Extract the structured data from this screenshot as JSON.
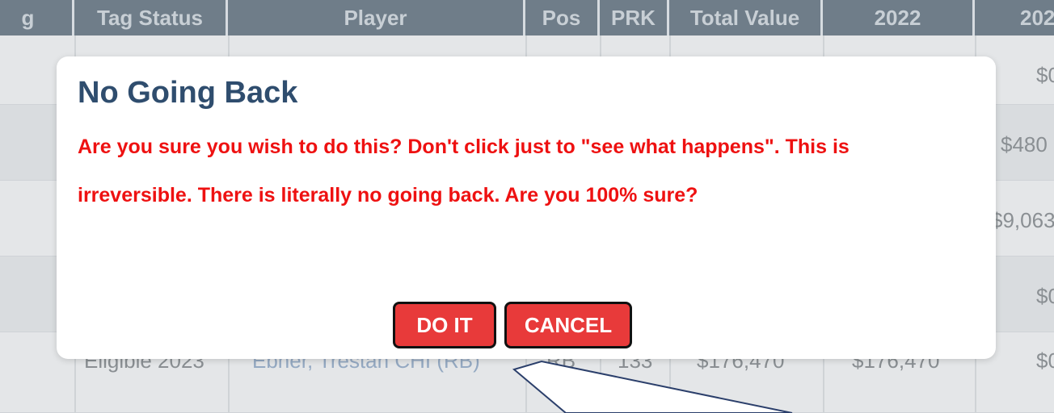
{
  "table": {
    "headers": [
      "g",
      "Tag Status",
      "Player",
      "Pos",
      "PRK",
      "Total Value",
      "2022",
      "202"
    ],
    "visible_row": {
      "tag_status": "Eligible 2023",
      "player": "Ebner, Trestan CHI (RB)",
      "pos": "RB",
      "prk": "133",
      "total_value": "$176,470",
      "value_2022": "$176,470",
      "value_2023": "$0"
    },
    "right_edge_values": [
      "$0",
      "$480",
      "$9,063",
      "$0"
    ]
  },
  "modal": {
    "title": "No Going Back",
    "message": "Are you sure you wish to do this? Don't click just to \"see what happens\". This is irreversible. There is literally no going back. Are you 100% sure?",
    "confirm_label": "DO IT",
    "cancel_label": "CANCEL"
  },
  "colors": {
    "title": "#2f4d6e",
    "warning_text": "#ee1111",
    "button_bg": "#e83a3a",
    "header_bg": "#6f7d89"
  },
  "icons": {
    "annotation": "arrow-callout"
  }
}
